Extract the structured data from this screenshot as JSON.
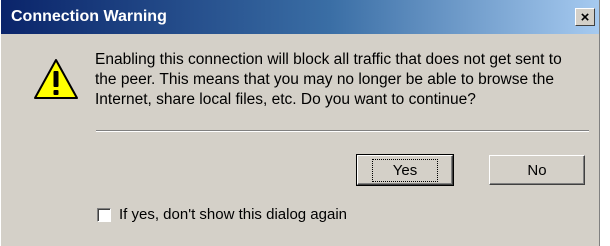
{
  "window": {
    "title": "Connection Warning",
    "close_label": "×"
  },
  "icon": {
    "name": "warning-icon",
    "glyph": "!",
    "color": "#ffff00"
  },
  "message": {
    "text": "Enabling this connection will block all traffic that does not get sent to\nthe peer. This means that you may no longer be able to browse the\nInternet, share local files, etc. Do you want to continue?"
  },
  "buttons": {
    "yes_label": "Yes",
    "no_label": "No"
  },
  "checkbox": {
    "label": "If yes, don't show this dialog again",
    "checked": false
  },
  "colors": {
    "dialog_bg": "#d4d0c8",
    "title_start": "#0a246a",
    "title_end": "#a6caf0"
  }
}
